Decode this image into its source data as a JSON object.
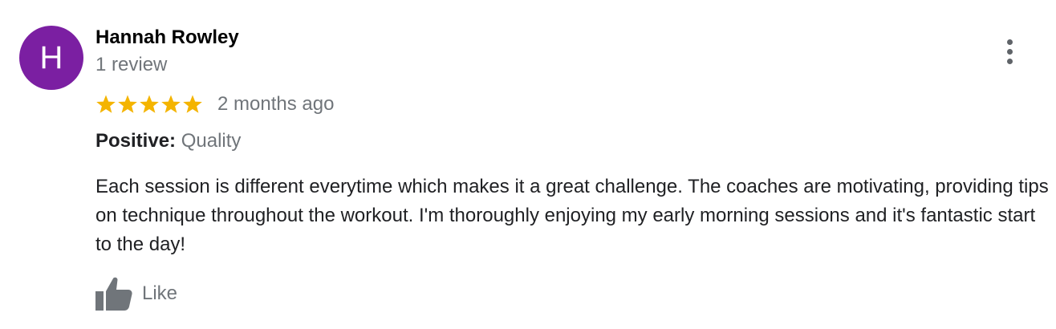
{
  "review": {
    "avatar": {
      "initial": "H",
      "color": "#7b1fa2"
    },
    "reviewer_name": "Hannah Rowley",
    "review_count": "1 review",
    "rating": 5,
    "rating_max": 5,
    "star_color": "#f4b400",
    "time_ago": "2 months ago",
    "highlight": {
      "label": "Positive:",
      "value": "Quality"
    },
    "text": "Each session is different everytime which makes it a great challenge. The coaches are motivating, providing tips on technique throughout the workout. I'm thoroughly enjoying my early morning sessions and it's fantastic start to the day!",
    "like_label": "Like",
    "icons": {
      "more_options": "more-vert-icon",
      "like": "thumb-up-icon",
      "star": "star-icon"
    }
  }
}
